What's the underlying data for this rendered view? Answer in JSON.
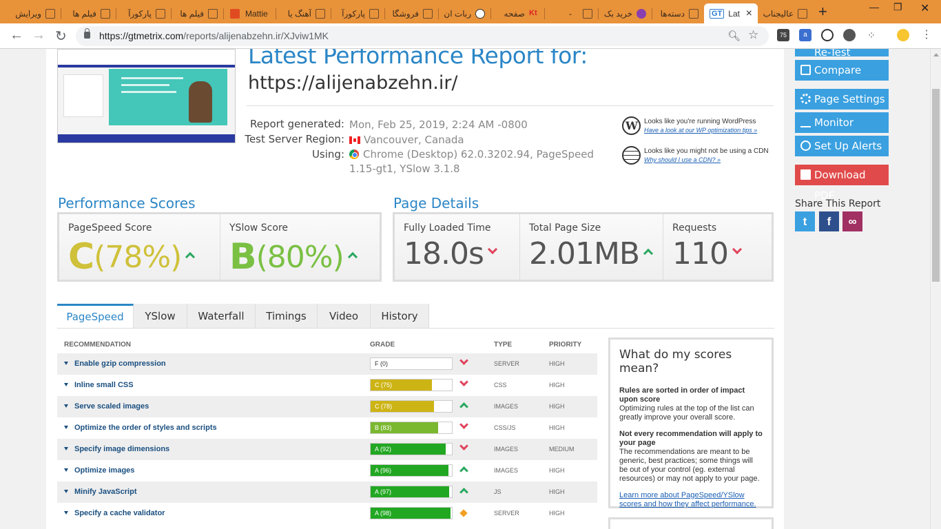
{
  "browser": {
    "tabs": [
      {
        "label": "ویرایش",
        "icon": "doc-icon"
      },
      {
        "label": "فیلم ها",
        "icon": "doc-icon"
      },
      {
        "label": "پارکورآ",
        "icon": "doc-icon"
      },
      {
        "label": "فیلم ها",
        "icon": "doc-icon"
      },
      {
        "label": "Mattie",
        "icon": "red-square-icon"
      },
      {
        "label": "آهنگ یا",
        "icon": "doc-icon"
      },
      {
        "label": "پارکورآ",
        "icon": "doc-icon"
      },
      {
        "label": "فروشگا",
        "icon": "doc-icon"
      },
      {
        "label": "ربات ان",
        "icon": "robot-icon"
      },
      {
        "label": "صفحه",
        "icon": "kt-icon"
      },
      {
        "label": "-",
        "icon": "doc-icon"
      },
      {
        "label": "خرید بک",
        "icon": "drop-icon"
      },
      {
        "label": "دسته‌ها",
        "icon": "doc-icon"
      }
    ],
    "active_tab": {
      "label": "Lat",
      "badge": "GT"
    },
    "last_tab": {
      "label": "عالیجناب",
      "icon": "doc-icon"
    },
    "url_host": "https://gtmetrix.com",
    "url_path": "/reports/alijenabzehn.ir/XJviw1MK",
    "ext_badge": "75"
  },
  "report": {
    "title": "Latest Performance Report for:",
    "site_url": "https://alijenabzehn.ir/",
    "meta": [
      {
        "key": "Report generated:",
        "value": "Mon, Feb 25, 2019, 2:24 AM -0800"
      },
      {
        "key": "Test Server Region:",
        "value": "Vancouver, Canada"
      },
      {
        "key": "Using:",
        "value": "Chrome (Desktop) 62.0.3202.94, PageSpeed 1.15-gt1, YSlow 3.1.8"
      }
    ],
    "notices": [
      {
        "text": "Looks like you're running WordPress",
        "link": "Have a look at our WP optimization tips »"
      },
      {
        "text": "Looks like you might not be using a CDN",
        "link": "Why should I use a CDN? »"
      }
    ]
  },
  "performance_scores": {
    "heading": "Performance Scores",
    "pagespeed": {
      "label": "PageSpeed Score",
      "grade": "C",
      "percent": "(78%)",
      "color": "#cfc13a",
      "trend": "up"
    },
    "yslow": {
      "label": "YSlow Score",
      "grade": "B",
      "percent": "(80%)",
      "color": "#7ac043",
      "trend": "up"
    }
  },
  "page_details": {
    "heading": "Page Details",
    "fully_loaded": {
      "label": "Fully Loaded Time",
      "value": "18.0s",
      "trend": "down"
    },
    "page_size": {
      "label": "Total Page Size",
      "value": "2.01MB",
      "trend": "up"
    },
    "requests": {
      "label": "Requests",
      "value": "110",
      "trend": "down"
    }
  },
  "report_tabs": [
    "PageSpeed",
    "YSlow",
    "Waterfall",
    "Timings",
    "Video",
    "History"
  ],
  "table": {
    "headers": {
      "recommendation": "RECOMMENDATION",
      "grade": "GRADE",
      "type": "TYPE",
      "priority": "PRIORITY"
    },
    "rows": [
      {
        "name": "Enable gzip compression",
        "grade": "F (0)",
        "score": 0,
        "color": "#ffffff",
        "trend": "down",
        "type": "SERVER",
        "priority": "HIGH"
      },
      {
        "name": "Inline small CSS",
        "grade": "C (75)",
        "score": 75,
        "color": "#cdb415",
        "trend": "down",
        "type": "CSS",
        "priority": "HIGH"
      },
      {
        "name": "Serve scaled images",
        "grade": "C (78)",
        "score": 78,
        "color": "#cdb415",
        "trend": "up",
        "type": "IMAGES",
        "priority": "HIGH"
      },
      {
        "name": "Optimize the order of styles and scripts",
        "grade": "B (83)",
        "score": 83,
        "color": "#7ab82f",
        "trend": "down",
        "type": "CSS/JS",
        "priority": "HIGH"
      },
      {
        "name": "Specify image dimensions",
        "grade": "A (92)",
        "score": 92,
        "color": "#22a722",
        "trend": "down",
        "type": "IMAGES",
        "priority": "MEDIUM"
      },
      {
        "name": "Optimize images",
        "grade": "A (96)",
        "score": 96,
        "color": "#22a722",
        "trend": "up",
        "type": "IMAGES",
        "priority": "HIGH"
      },
      {
        "name": "Minify JavaScript",
        "grade": "A (97)",
        "score": 97,
        "color": "#22a722",
        "trend": "up",
        "type": "JS",
        "priority": "HIGH"
      },
      {
        "name": "Specify a cache validator",
        "grade": "A (98)",
        "score": 98,
        "color": "#22a722",
        "trend": "same",
        "type": "SERVER",
        "priority": "HIGH"
      }
    ]
  },
  "scores_help": {
    "title": "What do my scores mean?",
    "b1": "Rules are sorted in order of impact upon score",
    "p1": "Optimizing rules at the top of the list can greatly improve your overall score.",
    "b2": "Not every recommendation will apply to your page",
    "p2": "The recommendations are meant to be generic, best practices; some things will be out of your control (eg. external resources) or may not apply to your page.",
    "link": "Learn more about PageSpeed/YSlow scores and how they affect performance."
  },
  "sidebar": {
    "retest": "Re-Test",
    "compare": "Compare",
    "page_settings": "Page Settings",
    "monitor": "Monitor",
    "alerts": "Set Up Alerts",
    "download": "Download PDF",
    "share_heading": "Share This Report"
  }
}
